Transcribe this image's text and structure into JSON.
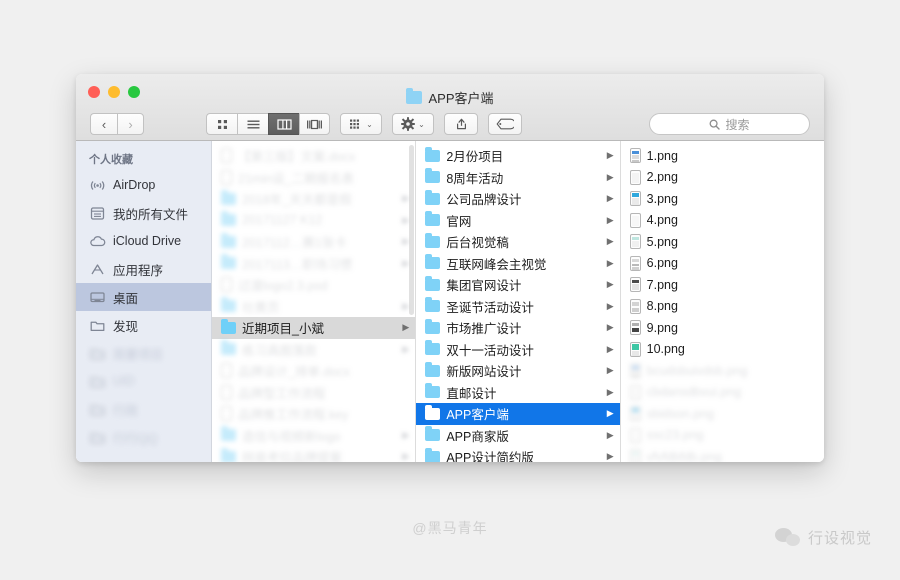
{
  "window": {
    "title": "APP客户端",
    "traffic_lights": [
      {
        "name": "close",
        "color": "#ff5f57"
      },
      {
        "name": "minimize",
        "color": "#febc2e"
      },
      {
        "name": "maximize",
        "color": "#28c840"
      }
    ]
  },
  "toolbar": {
    "back_label": "‹",
    "forward_label": "›",
    "views": [
      {
        "name": "icon-view",
        "active": false
      },
      {
        "name": "list-view",
        "active": false
      },
      {
        "name": "column-view",
        "active": true
      },
      {
        "name": "coverflow-view",
        "active": false
      }
    ],
    "arrange_label": "⌄",
    "action_label": "⌄",
    "share_name": "share-icon",
    "tag_name": "tag-icon"
  },
  "search": {
    "placeholder": "搜索",
    "value": "",
    "icon": "search-icon"
  },
  "sidebar": {
    "header": "个人收藏",
    "items": [
      {
        "label": "AirDrop",
        "icon": "airdrop-icon",
        "selected": false,
        "blurred": false
      },
      {
        "label": "我的所有文件",
        "icon": "all-files-icon",
        "selected": false,
        "blurred": false
      },
      {
        "label": "iCloud Drive",
        "icon": "icloud-icon",
        "selected": false,
        "blurred": false
      },
      {
        "label": "应用程序",
        "icon": "applications-icon",
        "selected": false,
        "blurred": false
      },
      {
        "label": "桌面",
        "icon": "desktop-icon",
        "selected": true,
        "blurred": false
      },
      {
        "label": "发现",
        "icon": "folder-icon",
        "selected": false,
        "blurred": false
      },
      {
        "label": "简要项目",
        "icon": "folder-icon",
        "selected": false,
        "blurred": true
      },
      {
        "label": "UID",
        "icon": "folder-icon",
        "selected": false,
        "blurred": true
      },
      {
        "label": "行政",
        "icon": "folder-icon",
        "selected": false,
        "blurred": true
      },
      {
        "label": "行行QQ",
        "icon": "folder-icon",
        "selected": false,
        "blurred": true
      }
    ]
  },
  "columns": [
    {
      "name": "column-1",
      "rows": [
        {
          "label": "【第三版】文案.docx",
          "type": "file",
          "arrow": false,
          "selected": "none",
          "blurred": true
        },
        {
          "label": "21min设_二期报名表",
          "type": "file",
          "arrow": false,
          "selected": "none",
          "blurred": true
        },
        {
          "label": "2018年_天天都是假",
          "type": "folder",
          "arrow": true,
          "selected": "none",
          "blurred": true
        },
        {
          "label": "20171127 K12",
          "type": "folder",
          "arrow": true,
          "selected": "none",
          "blurred": true
        },
        {
          "label": "2017112…赛1张卡",
          "type": "folder",
          "arrow": true,
          "selected": "none",
          "blurred": true
        },
        {
          "label": "2017113…职场习惯",
          "type": "folder",
          "arrow": true,
          "selected": "none",
          "blurred": true
        },
        {
          "label": "过渡logo2.3.psd",
          "type": "file",
          "arrow": false,
          "selected": "none",
          "blurred": true
        },
        {
          "label": "社黄页",
          "type": "folder",
          "arrow": true,
          "selected": "none",
          "blurred": true
        },
        {
          "label": "近期项目_小斌",
          "type": "folder",
          "arrow": true,
          "selected": "gray",
          "blurred": false
        },
        {
          "label": "练习具图落款",
          "type": "folder",
          "arrow": true,
          "selected": "none",
          "blurred": true
        },
        {
          "label": "品牌设计_排单.docx",
          "type": "file",
          "arrow": false,
          "selected": "none",
          "blurred": true
        },
        {
          "label": "品牌型工作流程",
          "type": "file",
          "arrow": false,
          "selected": "none",
          "blurred": true
        },
        {
          "label": "品牌推工作流程.key",
          "type": "file",
          "arrow": false,
          "selected": "none",
          "blurred": true
        },
        {
          "label": "造信与视频新logo",
          "type": "folder",
          "arrow": true,
          "selected": "none",
          "blurred": true
        },
        {
          "label": "网易考拉品牌提案",
          "type": "folder",
          "arrow": true,
          "selected": "none",
          "blurred": true
        }
      ]
    },
    {
      "name": "column-2",
      "rows": [
        {
          "label": "2月份项目",
          "type": "folder",
          "arrow": true,
          "selected": "none",
          "blurred": false
        },
        {
          "label": "8周年活动",
          "type": "folder",
          "arrow": true,
          "selected": "none",
          "blurred": false
        },
        {
          "label": "公司品牌设计",
          "type": "folder",
          "arrow": true,
          "selected": "none",
          "blurred": false
        },
        {
          "label": "官网",
          "type": "folder",
          "arrow": true,
          "selected": "none",
          "blurred": false
        },
        {
          "label": "后台视觉稿",
          "type": "folder",
          "arrow": true,
          "selected": "none",
          "blurred": false
        },
        {
          "label": "互联网峰会主视觉",
          "type": "folder",
          "arrow": true,
          "selected": "none",
          "blurred": false
        },
        {
          "label": "集团官网设计",
          "type": "folder",
          "arrow": true,
          "selected": "none",
          "blurred": false
        },
        {
          "label": "圣诞节活动设计",
          "type": "folder",
          "arrow": true,
          "selected": "none",
          "blurred": false
        },
        {
          "label": "市场推广设计",
          "type": "folder",
          "arrow": true,
          "selected": "none",
          "blurred": false
        },
        {
          "label": "双十一活动设计",
          "type": "folder",
          "arrow": true,
          "selected": "none",
          "blurred": false
        },
        {
          "label": "新版网站设计",
          "type": "folder",
          "arrow": true,
          "selected": "none",
          "blurred": false
        },
        {
          "label": "直邮设计",
          "type": "folder",
          "arrow": true,
          "selected": "none",
          "blurred": false
        },
        {
          "label": "APP客户端",
          "type": "folder",
          "arrow": true,
          "selected": "blue",
          "blurred": false
        },
        {
          "label": "APP商家版",
          "type": "folder",
          "arrow": true,
          "selected": "none",
          "blurred": false
        },
        {
          "label": "APP设计简约版",
          "type": "folder",
          "arrow": true,
          "selected": "none",
          "blurred": false
        }
      ]
    },
    {
      "name": "column-3",
      "rows": [
        {
          "label": "1.png",
          "type": "png",
          "arrow": false,
          "selected": "none",
          "blurred": false
        },
        {
          "label": "2.png",
          "type": "png",
          "arrow": false,
          "selected": "none",
          "blurred": false
        },
        {
          "label": "3.png",
          "type": "png",
          "arrow": false,
          "selected": "none",
          "blurred": false
        },
        {
          "label": "4.png",
          "type": "png",
          "arrow": false,
          "selected": "none",
          "blurred": false
        },
        {
          "label": "5.png",
          "type": "png",
          "arrow": false,
          "selected": "none",
          "blurred": false
        },
        {
          "label": "6.png",
          "type": "png",
          "arrow": false,
          "selected": "none",
          "blurred": false
        },
        {
          "label": "7.png",
          "type": "png",
          "arrow": false,
          "selected": "none",
          "blurred": false
        },
        {
          "label": "8.png",
          "type": "png",
          "arrow": false,
          "selected": "none",
          "blurred": false
        },
        {
          "label": "9.png",
          "type": "png",
          "arrow": false,
          "selected": "none",
          "blurred": false
        },
        {
          "label": "10.png",
          "type": "png",
          "arrow": false,
          "selected": "none",
          "blurred": false
        },
        {
          "label": "bcudsbuivdsb.png",
          "type": "png",
          "arrow": false,
          "selected": "none",
          "blurred": true
        },
        {
          "label": "cbdansdbvui.png",
          "type": "png",
          "arrow": false,
          "selected": "none",
          "blurred": true
        },
        {
          "label": "sbidson.png",
          "type": "png",
          "arrow": false,
          "selected": "none",
          "blurred": true
        },
        {
          "label": "ssc23.png",
          "type": "png",
          "arrow": false,
          "selected": "none",
          "blurred": true
        },
        {
          "label": "vfvfdbfdb.png",
          "type": "png",
          "arrow": false,
          "selected": "none",
          "blurred": true
        }
      ]
    }
  ],
  "watermarks": {
    "center": "@黑马青年",
    "badge": "行设视觉"
  },
  "colors": {
    "selection_blue": "#1176e8",
    "sidebar_selection": "#bcc7df",
    "folder_blue": "#7fd2f7",
    "background": "#f0f0f0"
  }
}
